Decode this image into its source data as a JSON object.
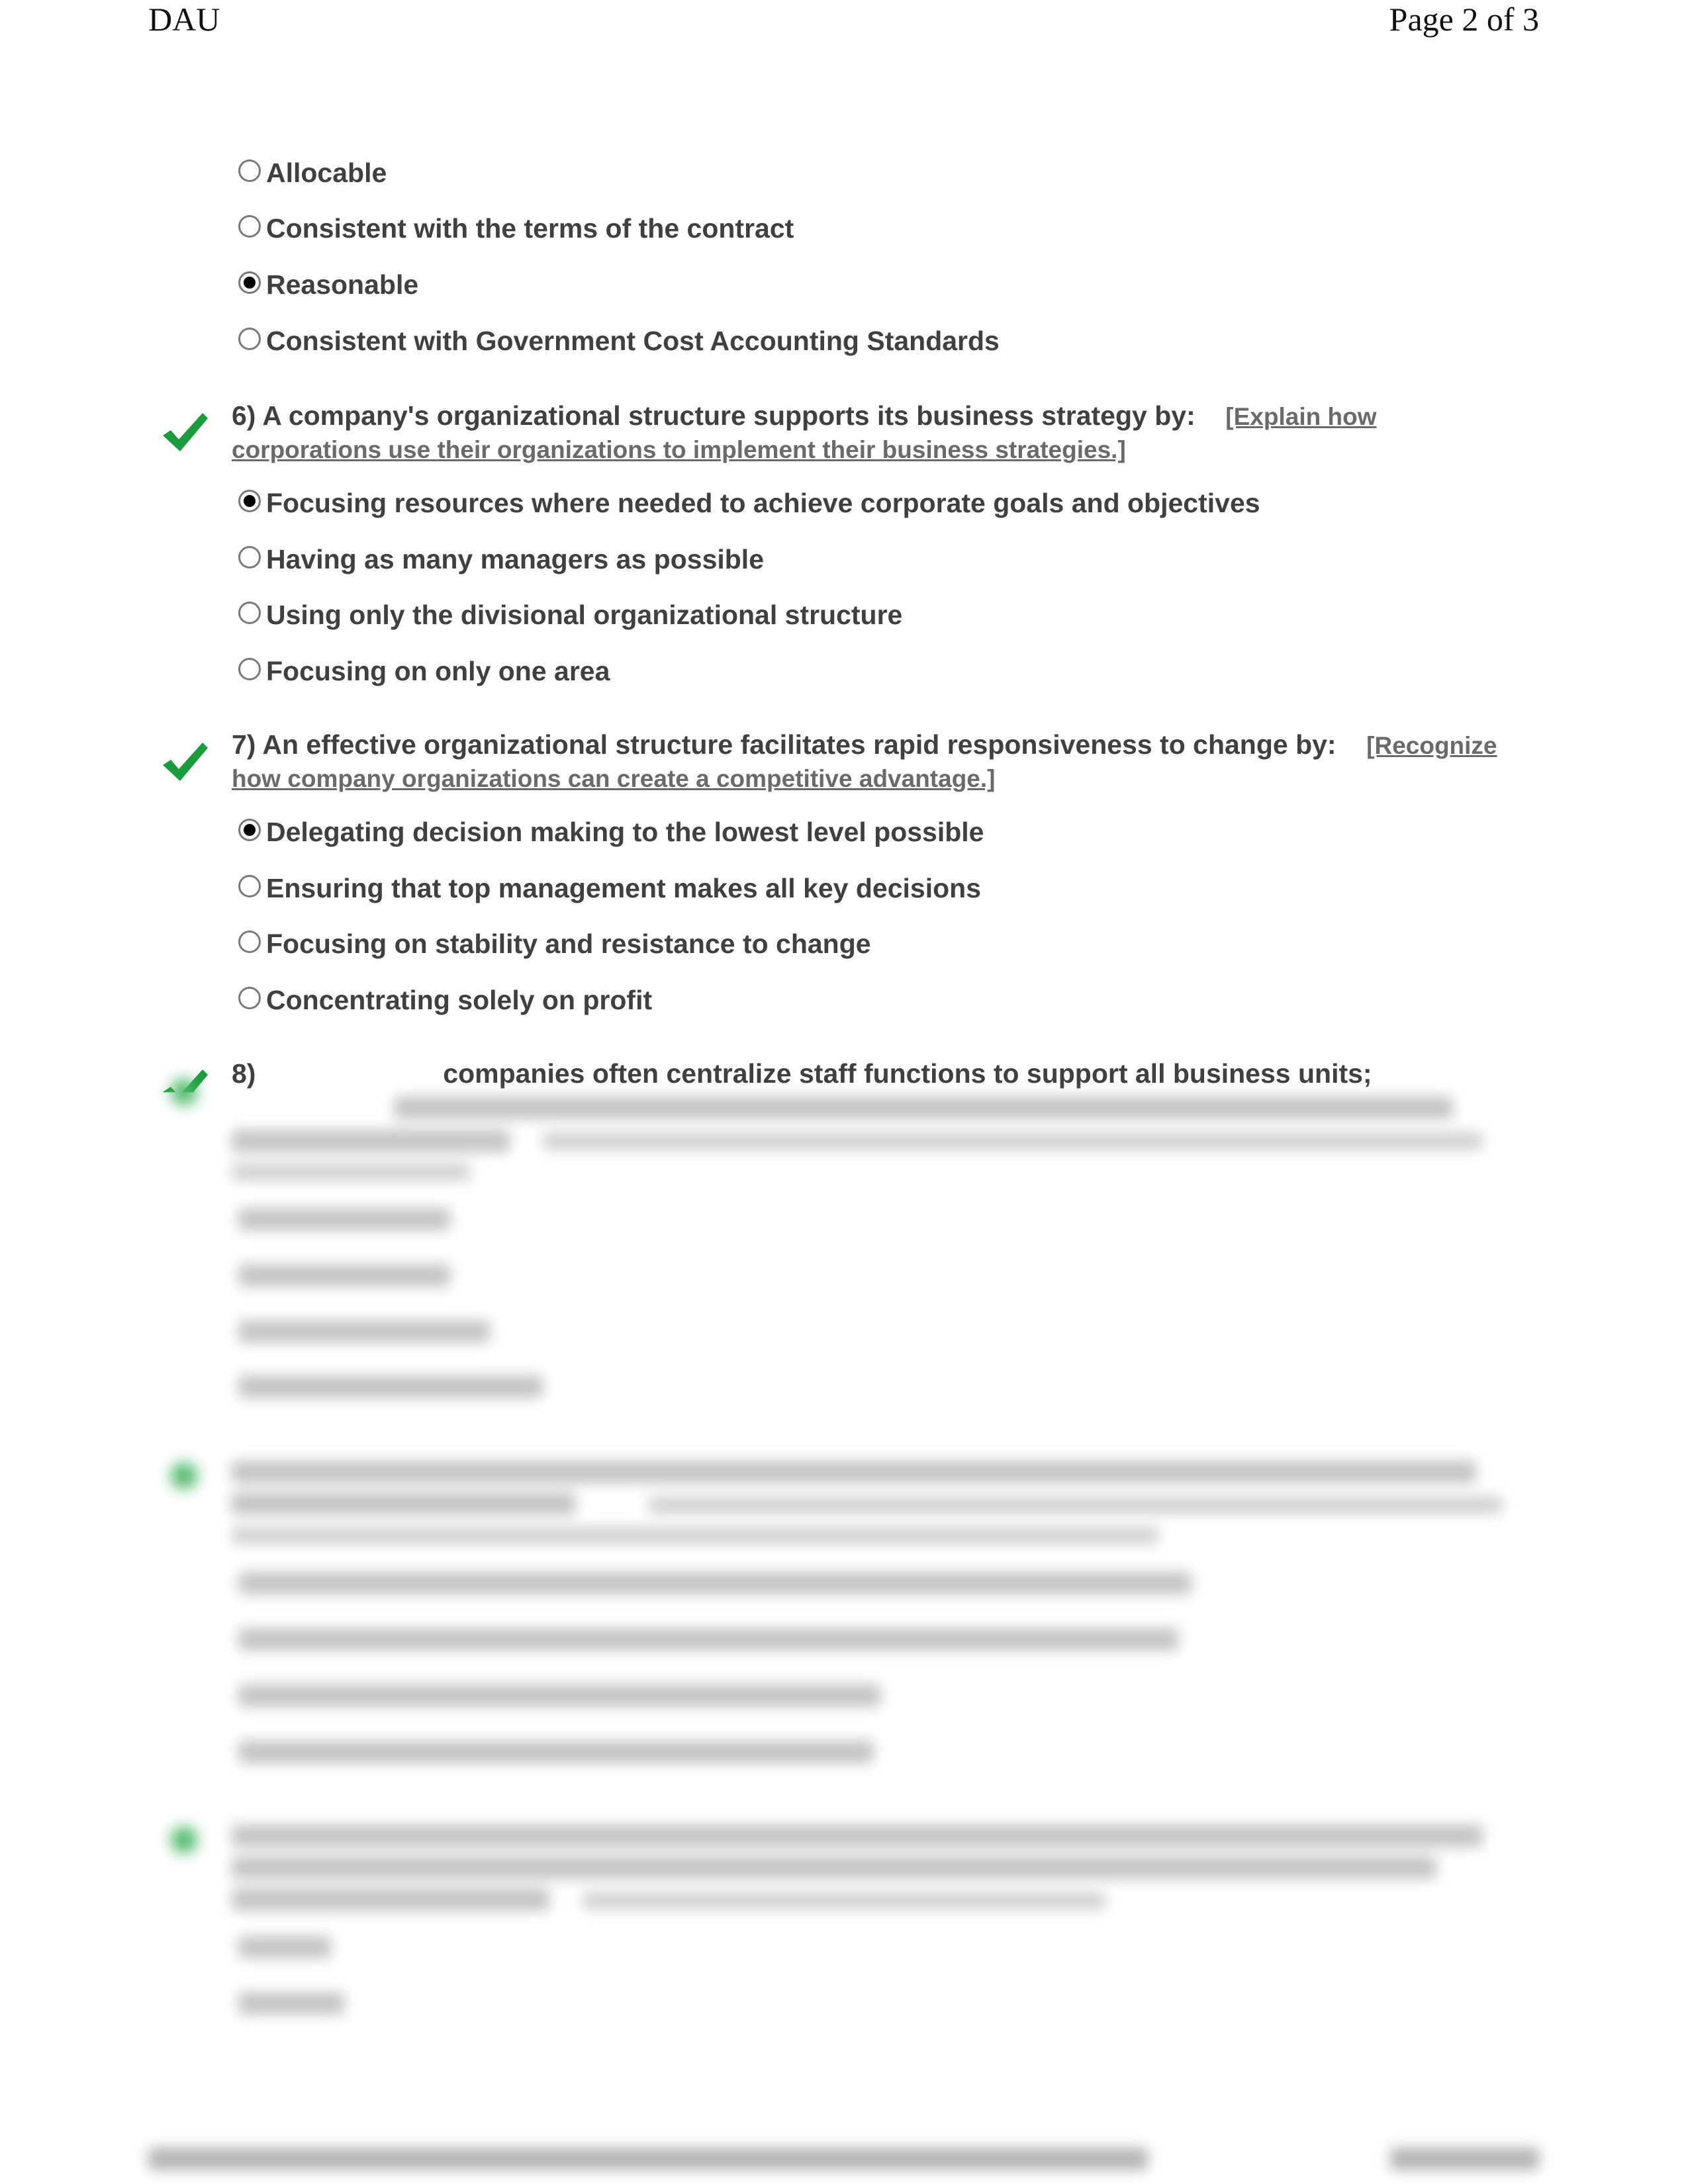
{
  "header": {
    "left": "DAU",
    "right": "Page 2 of 3"
  },
  "colors": {
    "check_green": "#1a9b3c",
    "text": "#404040",
    "link": "#6a6a6a"
  },
  "question5_options": [
    {
      "label": "Allocable",
      "selected": false
    },
    {
      "label": "Consistent with the terms of the contract",
      "selected": false
    },
    {
      "label": "Reasonable",
      "selected": true
    },
    {
      "label": "Consistent with Government Cost Accounting Standards",
      "selected": false
    }
  ],
  "question6": {
    "number": "6)",
    "text": "A company's organizational structure supports its business strategy by:",
    "link": "[Explain how corporations use their organizations to implement their business strategies.]",
    "status_icon": "check-icon",
    "options": [
      {
        "label": "Focusing resources where needed to achieve corporate goals and objectives",
        "selected": true
      },
      {
        "label": "Having as many managers as possible",
        "selected": false
      },
      {
        "label": "Using only the divisional organizational structure",
        "selected": false
      },
      {
        "label": "Focusing on only one area",
        "selected": false
      }
    ]
  },
  "question7": {
    "number": "7)",
    "text": "An effective organizational structure facilitates rapid responsiveness to change by:",
    "link": "[Recognize how company organizations can create a competitive advantage.]",
    "status_icon": "check-icon",
    "options": [
      {
        "label": "Delegating decision making to the lowest level possible",
        "selected": true
      },
      {
        "label": "Ensuring that top management makes all key decisions",
        "selected": false
      },
      {
        "label": "Focusing on stability and resistance to change",
        "selected": false
      },
      {
        "label": "Concentrating solely on profit",
        "selected": false
      }
    ]
  },
  "question8": {
    "number": "8)",
    "text": "companies often centralize staff functions to support all business units;",
    "status_icon": "check-icon",
    "blurred": true
  },
  "blurred_section": {
    "note": "Remaining content (questions 8–10 and footer) is blurred and not legible"
  }
}
